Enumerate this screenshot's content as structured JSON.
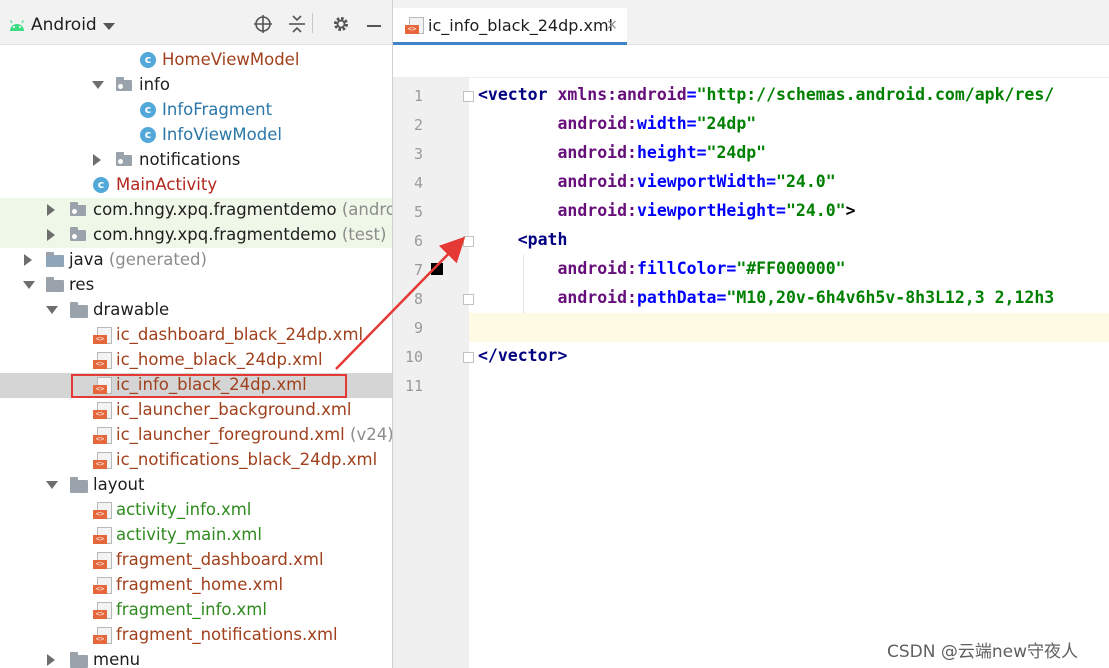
{
  "project_panel": {
    "title": "Android",
    "tree": [
      {
        "label": "HomeViewModel",
        "kind": "class",
        "color": "orange"
      },
      {
        "label": "info",
        "kind": "package",
        "expanded": true
      },
      {
        "label": "InfoFragment",
        "kind": "class",
        "color": "blue"
      },
      {
        "label": "InfoViewModel",
        "kind": "class",
        "color": "blue"
      },
      {
        "label": "notifications",
        "kind": "package",
        "expanded": false
      },
      {
        "label": "MainActivity",
        "kind": "class",
        "color": "red"
      },
      {
        "label": "com.hngy.xpq.fragmentdemo",
        "suffix": "(androidT",
        "kind": "package",
        "expanded": false
      },
      {
        "label": "com.hngy.xpq.fragmentdemo",
        "suffix": "(test)",
        "kind": "package",
        "expanded": false
      },
      {
        "label": "java",
        "suffix": "(generated)",
        "kind": "folder",
        "expanded": false
      },
      {
        "label": "res",
        "kind": "folder",
        "expanded": true
      },
      {
        "label": "drawable",
        "kind": "folder",
        "expanded": true
      },
      {
        "label": "ic_dashboard_black_24dp.xml",
        "kind": "xml",
        "color": "orange"
      },
      {
        "label": "ic_home_black_24dp.xml",
        "kind": "xml",
        "color": "orange"
      },
      {
        "label": "ic_info_black_24dp.xml",
        "kind": "xml",
        "color": "orange",
        "selected": true
      },
      {
        "label": "ic_launcher_background.xml",
        "kind": "xml",
        "color": "orange"
      },
      {
        "label": "ic_launcher_foreground.xml",
        "suffix": "(v24)",
        "kind": "xml",
        "color": "orange"
      },
      {
        "label": "ic_notifications_black_24dp.xml",
        "kind": "xml",
        "color": "orange"
      },
      {
        "label": "layout",
        "kind": "folder",
        "expanded": true
      },
      {
        "label": "activity_info.xml",
        "kind": "xml",
        "color": "green"
      },
      {
        "label": "activity_main.xml",
        "kind": "xml",
        "color": "green"
      },
      {
        "label": "fragment_dashboard.xml",
        "kind": "xml",
        "color": "orange"
      },
      {
        "label": "fragment_home.xml",
        "kind": "xml",
        "color": "orange"
      },
      {
        "label": "fragment_info.xml",
        "kind": "xml",
        "color": "green"
      },
      {
        "label": "fragment_notifications.xml",
        "kind": "xml",
        "color": "orange"
      },
      {
        "label": "menu",
        "kind": "folder",
        "expanded": false
      }
    ]
  },
  "editor": {
    "tab_label": "ic_info_black_24dp.xml",
    "tab_close": "×",
    "line_numbers": [
      "1",
      "2",
      "3",
      "4",
      "5",
      "6",
      "7",
      "8",
      "9",
      "10",
      "11"
    ],
    "code": {
      "l1_open": "<vector ",
      "l1_ns": "xmlns:",
      "l1_attr": "android",
      "l1_eq": "=",
      "l1_val": "\"http://schemas.android.com/apk/res/",
      "l2_ns": "android:",
      "l2_attr": "width",
      "l2_val": "\"24dp\"",
      "l3_ns": "android:",
      "l3_attr": "height",
      "l3_val": "\"24dp\"",
      "l4_ns": "android:",
      "l4_attr": "viewportWidth",
      "l4_val": "\"24.0\"",
      "l5_ns": "android:",
      "l5_attr": "viewportHeight",
      "l5_val": "\"24.0\"",
      "l5_close": ">",
      "l6_open": "<path",
      "l7_ns": "android:",
      "l7_attr": "fillColor",
      "l7_val": "\"#FF000000\"",
      "l8_ns": "android:",
      "l8_attr": "pathData",
      "l8_val": "\"M10,20v-6h4v6h5v-8h3L12,3 2,12h3",
      "l10_close": "</vector>",
      "eq": "="
    }
  },
  "watermark": "CSDN @云端new守夜人",
  "colors": {
    "highlight_box": "#e53935",
    "arrow": "#e53935",
    "tab_underline": "#4083c9"
  }
}
